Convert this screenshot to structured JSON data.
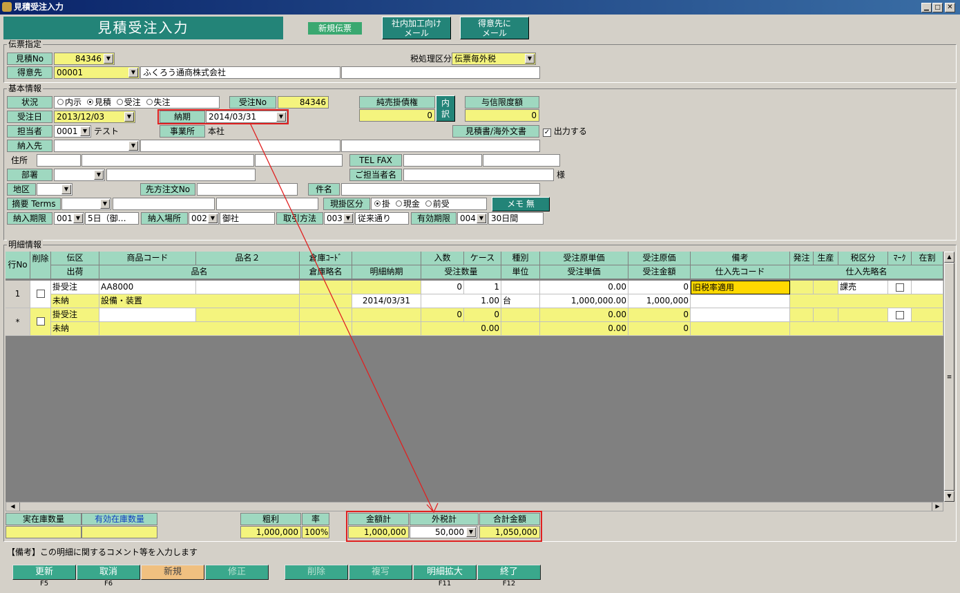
{
  "window": {
    "title": "見積受注入力"
  },
  "header": {
    "title": "見積受注入力",
    "badge": "新規伝票",
    "mail_internal": "社内加工向け\nメール",
    "mail_customer": "得意先に\nメール"
  },
  "denpyo": {
    "group": "伝票指定",
    "mitsumori_no_label": "見積No",
    "mitsumori_no": "84346",
    "zei_label": "税処理区分",
    "zei_value": "伝票毎外税",
    "tokui_label": "得意先",
    "tokui_code": "00001",
    "tokui_name": "ふくろう通商株式会社"
  },
  "kihon": {
    "group": "基本情報",
    "jokyo_label": "状況",
    "status_options": [
      "内示",
      "見積",
      "受注",
      "失注"
    ],
    "status_selected": "見積",
    "juchu_no_label": "受注No",
    "juchu_no": "84346",
    "junuri_label": "純売掛債権",
    "junuri_value": "0",
    "uchiwake": "内\n訳",
    "yoshin_label": "与信限度額",
    "yoshin_value": "0",
    "juchubi_label": "受注日",
    "juchubi": "2013/12/03",
    "nouki_label": "納期",
    "nouki": "2014/03/31",
    "tanto_label": "担当者",
    "tanto_code": "0001",
    "tanto_name": "テスト",
    "jigyo_label": "事業所",
    "jigyo_value": "本社",
    "mitsumorisho_label": "見積書/海外文書",
    "output_label": "出力する",
    "nonyu_label": "納入先",
    "jusho_label": "住所",
    "tel_label": "TEL FAX",
    "busho_label": "部署",
    "gotanto_label": "ご担当者名",
    "sama": "様",
    "chiku_label": "地区",
    "sakichumon_label": "先方注文No",
    "kenmei_label": "件名",
    "tekiyo_label": "摘要 Terms",
    "genkake_label": "現掛区分",
    "genkake_options": [
      "掛",
      "現金",
      "前受"
    ],
    "genkake_selected": "掛",
    "memo_button": "メモ 無",
    "nonyukigen_label": "納入期限",
    "nonyukigen_code": "001",
    "nonyukigen_text": "5日（御…",
    "nonyubasho_label": "納入場所",
    "nonyubasho_code": "002",
    "nonyubasho_text": "御社",
    "torihiki_label": "取引方法",
    "torihiki_code": "003",
    "torihiki_text": "従来通り",
    "yuko_label": "有効期限",
    "yuko_code": "004",
    "yuko_text": "30日間"
  },
  "meisai": {
    "group": "明細情報",
    "headers1": [
      "行No",
      "削除",
      "伝区",
      "商品コード",
      "品名２",
      "倉庫ｺｰﾄﾞ",
      "",
      "入数",
      "ケース",
      "種別",
      "受注原単価",
      "受注原価",
      "備考",
      "発注",
      "生産",
      "税区分",
      "ﾏｰｸ",
      "在割"
    ],
    "headers2": [
      "出荷",
      "品名",
      "倉庫略名",
      "明細納期",
      "受注数量",
      "単位",
      "受注単価",
      "受注金額",
      "仕入先コード",
      "仕入先略名"
    ],
    "rows": [
      {
        "no": "1",
        "denku": "掛受注",
        "code": "AA8000",
        "irisu": "0",
        "case": "1",
        "genka_tanka": "0.00",
        "genka": "0",
        "biko": "旧税率適用",
        "zeiku": "課売",
        "shukka": "未納",
        "hinmei": "設備・装置",
        "nouki": "2014/03/31",
        "suryo": "1.00",
        "tani": "台",
        "tanka": "1,000,000.00",
        "kingaku": "1,000,000"
      },
      {
        "no": "*",
        "denku": "掛受注",
        "code": "",
        "irisu": "0",
        "case": "0",
        "genka_tanka": "0.00",
        "genka": "0",
        "biko": "",
        "zeiku": "",
        "shukka": "未納",
        "hinmei": "",
        "nouki": "",
        "suryo": "0.00",
        "tani": "",
        "tanka": "0.00",
        "kingaku": "0"
      }
    ]
  },
  "footer": {
    "jitsuzaiko_label": "実在庫数量",
    "yukozaiko_label": "有効在庫数量",
    "arari_label": "粗利",
    "arari_value": "1,000,000",
    "ritsu_label": "率",
    "ritsu_value": "100%",
    "kingaku_label": "金額計",
    "kingaku_value": "1,000,000",
    "gaizei_label": "外税計",
    "gaizei_value": "50,000",
    "gokei_label": "合計金額",
    "gokei_value": "1,050,000",
    "comment": "【備考】この明細に関するコメント等を入力します"
  },
  "fkeys": [
    {
      "label": "更新",
      "key": "F5"
    },
    {
      "label": "取消",
      "key": "F6"
    },
    {
      "label": "新規",
      "key": ""
    },
    {
      "label": "修正",
      "key": ""
    },
    {
      "label": "削除",
      "key": ""
    },
    {
      "label": "複写",
      "key": ""
    },
    {
      "label": "明細拡大",
      "key": "F11"
    },
    {
      "label": "終了",
      "key": "F12"
    }
  ],
  "colors": {
    "title_bar": "#0a246a",
    "header": "#238478",
    "label": "#9fd8c0",
    "input": "#f4f47e",
    "annotation": "#e02020"
  }
}
